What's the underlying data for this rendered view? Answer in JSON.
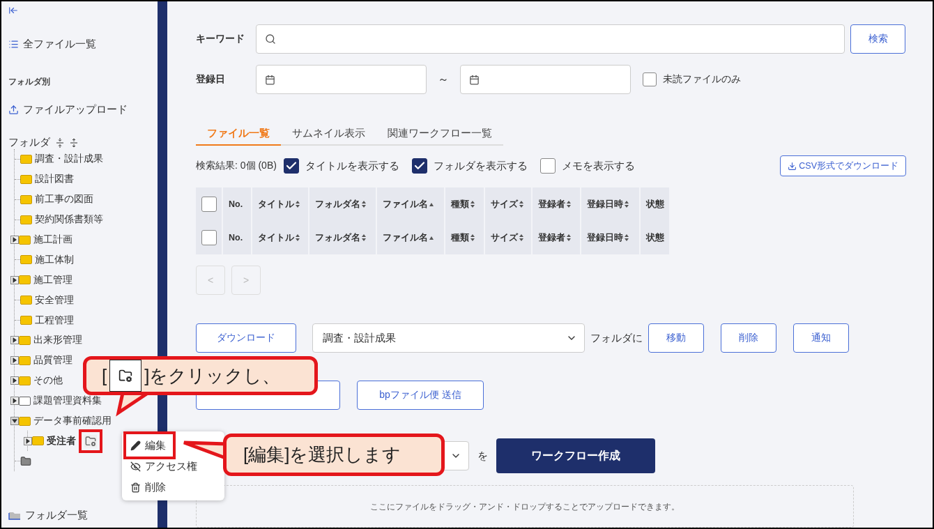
{
  "sidebar": {
    "all_files": "全ファイル一覧",
    "section_label": "フォルダ別",
    "upload": "ファイルアップロード",
    "folder_heading": "フォルダ",
    "tree": [
      {
        "label": "調査・設計成果",
        "expandable": false,
        "empty": false,
        "selected": false
      },
      {
        "label": "設計図書",
        "expandable": false,
        "empty": false,
        "selected": false
      },
      {
        "label": "前工事の図面",
        "expandable": false,
        "empty": false,
        "selected": false
      },
      {
        "label": "契約関係書類等",
        "expandable": false,
        "empty": false,
        "selected": false
      },
      {
        "label": "施工計画",
        "expandable": true,
        "expanded": false,
        "empty": false,
        "selected": false
      },
      {
        "label": "施工体制",
        "expandable": false,
        "empty": false,
        "selected": false
      },
      {
        "label": "施工管理",
        "expandable": true,
        "expanded": false,
        "empty": false,
        "selected": false
      },
      {
        "label": "安全管理",
        "expandable": false,
        "empty": false,
        "selected": false
      },
      {
        "label": "工程管理",
        "expandable": false,
        "empty": false,
        "selected": false
      },
      {
        "label": "出来形管理",
        "expandable": true,
        "expanded": false,
        "empty": false,
        "selected": false
      },
      {
        "label": "品質管理",
        "expandable": true,
        "expanded": false,
        "empty": false,
        "selected": false
      },
      {
        "label": "その他",
        "expandable": true,
        "expanded": false,
        "empty": false,
        "selected": false
      },
      {
        "label": "課題管理資料集",
        "expandable": true,
        "expanded": false,
        "empty": true,
        "selected": false
      },
      {
        "label": "データ事前確認用",
        "expandable": true,
        "expanded": true,
        "empty": false,
        "selected": false,
        "children": [
          {
            "label": "受注者",
            "expandable": true,
            "expanded": false,
            "empty": false,
            "selected": true,
            "settings_highlighted": true
          }
        ]
      }
    ],
    "folder_list": "フォルダ一覧"
  },
  "search": {
    "label": "キーワード",
    "button": "検索"
  },
  "date": {
    "label": "登録日",
    "separator": "～"
  },
  "unread": {
    "label": "未読ファイルのみ",
    "checked": false
  },
  "tabs": [
    {
      "label": "ファイル一覧",
      "selected": true
    },
    {
      "label": "サムネイル表示",
      "selected": false
    },
    {
      "label": "関連ワークフロー一覧",
      "selected": false
    }
  ],
  "result_count": "検索結果: 0個 (0B)",
  "toggles": [
    {
      "label": "タイトルを表示する",
      "checked": true
    },
    {
      "label": "フォルダを表示する",
      "checked": true
    },
    {
      "label": "メモを表示する",
      "checked": false
    }
  ],
  "csv_button": "CSV形式でダウンロード",
  "table": {
    "header_rows": [
      {
        "checked": false,
        "columns": [
          {
            "label": "No.",
            "kind": "plain"
          },
          {
            "label": "タイトル",
            "kind": "sortable"
          },
          {
            "label": "フォルダ名",
            "kind": "sortable"
          },
          {
            "label": "ファイル名",
            "kind": "ascending"
          },
          {
            "label": "種類",
            "kind": "sortable"
          },
          {
            "label": "サイズ",
            "kind": "sortable"
          },
          {
            "label": "登録者",
            "kind": "sortable"
          },
          {
            "label": "登録日時",
            "kind": "sortable"
          },
          {
            "label": "状態",
            "kind": "plain"
          }
        ]
      },
      {
        "checked": false,
        "columns": [
          {
            "label": "No.",
            "kind": "plain"
          },
          {
            "label": "タイトル",
            "kind": "sortable"
          },
          {
            "label": "フォルダ名",
            "kind": "sortable"
          },
          {
            "label": "ファイル名",
            "kind": "ascending"
          },
          {
            "label": "種類",
            "kind": "sortable"
          },
          {
            "label": "サイズ",
            "kind": "sortable"
          },
          {
            "label": "登録者",
            "kind": "sortable"
          },
          {
            "label": "登録日時",
            "kind": "sortable"
          },
          {
            "label": "状態",
            "kind": "plain"
          }
        ]
      }
    ]
  },
  "pager": [
    {
      "label": "<",
      "disabled": true
    },
    {
      "label": ">",
      "disabled": true
    }
  ],
  "actions": {
    "download": "ダウンロード",
    "folder_select": "調査・設計成果",
    "folder_suffix": "フォルダに",
    "buttons": [
      "移動",
      "削除",
      "通知"
    ]
  },
  "send_button": "bpファイル便 送信",
  "workflow": {
    "suffix": "を",
    "button": "ワークフロー作成"
  },
  "dropzone": "ここにファイルをドラッグ・アンド・ドロップすることでアップロードできます。",
  "context_menu": [
    {
      "label": "編集",
      "kind": "edit",
      "highlighted": true
    },
    {
      "label": "アクセス権",
      "kind": "access",
      "highlighted": false
    },
    {
      "label": "削除",
      "kind": "delete",
      "highlighted": false
    }
  ],
  "callouts": [
    {
      "kind": "icon",
      "before": "[",
      "after": "]をクリックし、"
    },
    {
      "kind": "text",
      "text": "[編集]を選択します"
    }
  ]
}
